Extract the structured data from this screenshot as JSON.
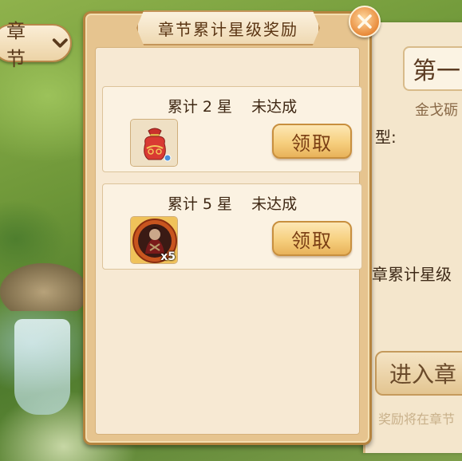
{
  "background": {
    "chapter_tab_label": "章节",
    "info_panel": {
      "title": "第一",
      "subtitle": "金戈砺",
      "type_label": "型:",
      "stars_label": "章累计星级",
      "enter_button": "进入章",
      "note": "奖励将在章节"
    }
  },
  "modal": {
    "title": "章节累计星级奖励",
    "rewards": [
      {
        "requirement": "累计 2 星",
        "status": "未达成",
        "item_icon": "red-treasure-pouch-icon",
        "item_count": "",
        "claim_label": "领取"
      },
      {
        "requirement": "累计 5 星",
        "status": "未达成",
        "item_icon": "hero-portrait-medallion-icon",
        "item_count": "x5",
        "claim_label": "领取"
      }
    ]
  },
  "colors": {
    "frame": "#e6c48f",
    "panel": "#f7e9d3",
    "button": "#f6cf7e",
    "button_text": "#7a3e14",
    "close": "#e88a3a"
  }
}
